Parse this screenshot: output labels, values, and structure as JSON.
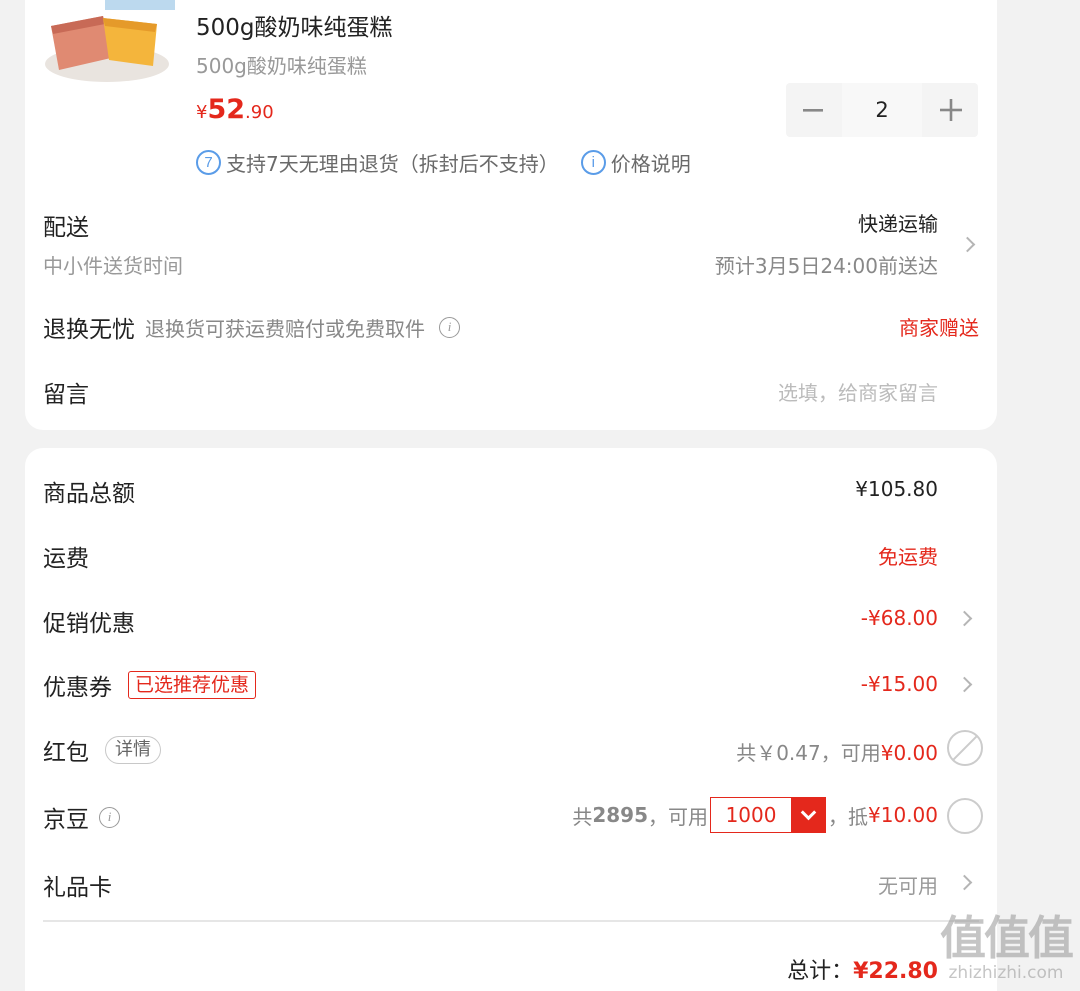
{
  "product": {
    "name": "500g酸奶味纯蛋糕",
    "spec": "500g酸奶味纯蛋糕",
    "price_currency": "¥",
    "price_integer": "52",
    "price_decimal": ".90",
    "quantity": "2",
    "return_tag": "支持7天无理由退货（拆封后不支持）",
    "return_tag_icon_text": "7",
    "price_note": "价格说明",
    "price_note_icon_text": "i"
  },
  "delivery": {
    "label": "配送",
    "sub": "中小件送货时间",
    "method": "快递运输",
    "eta": "预计3月5日24:00前送达"
  },
  "return_worry_free": {
    "label": "退换无忧",
    "desc": "退换货可获运费赔付或免费取件",
    "value": "商家赠送"
  },
  "message": {
    "label": "留言",
    "placeholder": "选填，给商家留言"
  },
  "summary": {
    "goods_total_label": "商品总额",
    "goods_total_value": "¥105.80",
    "shipping_label": "运费",
    "shipping_value": "免运费",
    "promo_label": "促销优惠",
    "promo_value": "-¥68.00",
    "coupon_label": "优惠券",
    "coupon_tag": "已选推荐优惠",
    "coupon_value": "-¥15.00",
    "redpacket_label": "红包",
    "redpacket_tag": "详情",
    "redpacket_total": "共￥0.47，可用",
    "redpacket_available": "¥0.00",
    "jd_bean_label": "京豆",
    "jd_bean_total_prefix": "共",
    "jd_bean_total": "2895",
    "jd_bean_usable": "，可用",
    "jd_bean_selected": "1000",
    "jd_bean_deduct_prefix": "，抵",
    "jd_bean_deduct": "¥10.00",
    "giftcard_label": "礼品卡",
    "giftcard_value": "无可用",
    "total_label": "总计：",
    "total_value": "¥22.80"
  },
  "watermark": {
    "big": "值值值",
    "small": "zhizhizhi.com"
  },
  "colors": {
    "accent_red": "#e4281c",
    "info_blue": "#5a9ce8",
    "background": "#f2f2f2"
  }
}
